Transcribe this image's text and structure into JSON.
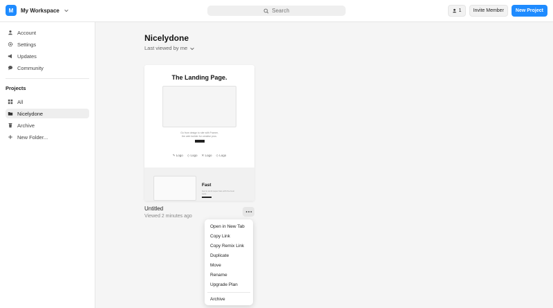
{
  "workspace": {
    "initial": "M",
    "name": "My Workspace"
  },
  "search": {
    "label": "Search"
  },
  "header": {
    "members_count": "1",
    "invite_label": "Invite Member",
    "new_project_label": "New Project"
  },
  "sidebar": {
    "top_items": [
      "Account",
      "Settings",
      "Updates",
      "Community"
    ],
    "projects_title": "Projects",
    "project_items": [
      "All",
      "Nicelydone",
      "Archive",
      "New Folder..."
    ],
    "active": "Nicelydone"
  },
  "main": {
    "folder_title": "Nicelydone",
    "sort_label": "Last viewed by me"
  },
  "card": {
    "preview_title": "The Landing Page.",
    "preview_tagline": "Go from design to site with Framer, the web builder for creative pros.",
    "logos": [
      "Logo",
      "Logo",
      "Logo",
      "Logo"
    ],
    "bottom_title": "Fast",
    "bottom_text": "Get to work super fast with the best tools",
    "name": "Untitled",
    "meta": "Viewed 2 minutes ago"
  },
  "context_menu": {
    "items": [
      "Open in New Tab",
      "Copy Link",
      "Copy Remix Link",
      "Duplicate",
      "Move",
      "Rename",
      "Upgrade Plan"
    ],
    "footer_item": "Archive"
  },
  "colors": {
    "accent": "#1e8bff",
    "sidebar_bg": "#ffffff",
    "canvas_bg": "#f5f5f5"
  }
}
